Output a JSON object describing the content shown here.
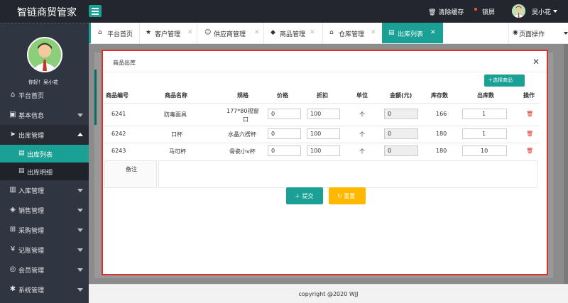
{
  "header": {
    "brand": "智链商贸管家",
    "clear_cache": "清除缓存",
    "lock_screen": "锁屏",
    "username": "吴小花",
    "accent": "#1aa094"
  },
  "sidebar": {
    "greeting": "你好！吴小花",
    "items": [
      {
        "label": "平台首页",
        "icon": "home-icon"
      },
      {
        "label": "基本信息",
        "icon": "info-icon"
      },
      {
        "label": "出库管理",
        "icon": "send-icon"
      },
      {
        "label": "入库管理",
        "icon": "file-icon"
      },
      {
        "label": "销售管理",
        "icon": "tag-icon"
      },
      {
        "label": "采购管理",
        "icon": "cart-icon"
      },
      {
        "label": "记账管理",
        "icon": "yen-icon"
      },
      {
        "label": "会员管理",
        "icon": "cube-icon"
      },
      {
        "label": "系统管理",
        "icon": "gear-icon"
      }
    ],
    "sub_items": [
      {
        "label": "出库列表",
        "active": true
      },
      {
        "label": "出库明细",
        "active": false
      }
    ]
  },
  "tabs": [
    {
      "label": "平台首页"
    },
    {
      "label": "客户管理"
    },
    {
      "label": "供应商管理"
    },
    {
      "label": "商品管理"
    },
    {
      "label": "仓库管理"
    },
    {
      "label": "出库列表"
    }
  ],
  "page_ops": "页面操作",
  "modal": {
    "title": "商品出库",
    "pick_button": "选择商品",
    "columns": [
      "商品编号",
      "商品名称",
      "规格",
      "价格",
      "折扣",
      "单位",
      "金额(元)",
      "库存数",
      "出库数",
      "操作"
    ],
    "rows": [
      {
        "code": "6241",
        "name": "防毒面具",
        "spec": "177*80视窗口",
        "spec_line1": "177*80视窗",
        "spec_line2": "口",
        "price": "0",
        "discount": "100",
        "unit": "个",
        "amount": "0",
        "stock": "166",
        "qty": "1"
      },
      {
        "code": "6242",
        "name": "口杯",
        "spec": "水晶六楞杯",
        "price": "0",
        "discount": "100",
        "unit": "个",
        "amount": "0",
        "stock": "180",
        "qty": "1"
      },
      {
        "code": "6243",
        "name": "马可杯",
        "spec": "骨瓷小v杯",
        "price": "0",
        "discount": "100",
        "unit": "个",
        "amount": "0",
        "stock": "180",
        "qty": "10"
      }
    ],
    "remark_label": "备注",
    "submit": "提交",
    "reset": "重置"
  },
  "footer": "copyright @2020 WJJ"
}
